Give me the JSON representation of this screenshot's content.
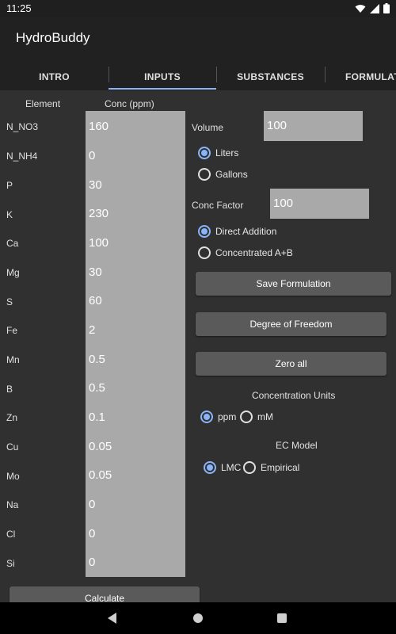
{
  "status": {
    "time": "11:25"
  },
  "app": {
    "title": "HydroBuddy"
  },
  "tabs": [
    {
      "label": "INTRO"
    },
    {
      "label": "INPUTS"
    },
    {
      "label": "SUBSTANCES"
    },
    {
      "label": "FORMULATI"
    }
  ],
  "table": {
    "header_element": "Element",
    "header_conc": "Conc (ppm)",
    "rows": [
      {
        "element": "N_NO3",
        "value": "160"
      },
      {
        "element": "N_NH4",
        "value": "0"
      },
      {
        "element": "P",
        "value": "30"
      },
      {
        "element": "K",
        "value": "230"
      },
      {
        "element": "Ca",
        "value": "100"
      },
      {
        "element": "Mg",
        "value": "30"
      },
      {
        "element": "S",
        "value": "60"
      },
      {
        "element": "Fe",
        "value": "2"
      },
      {
        "element": "Mn",
        "value": "0.5"
      },
      {
        "element": "B",
        "value": "0.5"
      },
      {
        "element": "Zn",
        "value": "0.1"
      },
      {
        "element": "Cu",
        "value": "0.05"
      },
      {
        "element": "Mo",
        "value": "0.05"
      },
      {
        "element": "Na",
        "value": "0"
      },
      {
        "element": "Cl",
        "value": "0"
      },
      {
        "element": "Si",
        "value": "0"
      }
    ]
  },
  "volume": {
    "label": "Volume",
    "value": "100"
  },
  "units": {
    "liters": "Liters",
    "gallons": "Gallons",
    "selected": "liters"
  },
  "conc_factor": {
    "label": "Conc Factor",
    "value": "100"
  },
  "mode": {
    "direct": "Direct Addition",
    "concentrated": "Concentrated A+B",
    "selected": "direct"
  },
  "buttons": {
    "save": "Save Formulation",
    "degree": "Degree of Freedom",
    "zero": "Zero all",
    "calculate": "Calculate"
  },
  "conc_units": {
    "label": "Concentration Units",
    "ppm": "ppm",
    "mm": "mM",
    "selected": "ppm"
  },
  "ec_model": {
    "label": "EC Model",
    "lmc": "LMC",
    "empirical": "Empirical",
    "selected": "lmc"
  },
  "colors": {
    "accent": "#8ab4f8",
    "panel": "#a9a9a9",
    "background": "#303030",
    "button": "#5a5a5a"
  },
  "icons": {
    "status": [
      "wifi-icon",
      "cell-signal-icon",
      "battery-icon"
    ],
    "nav": [
      "back-icon",
      "home-icon",
      "recent-apps-icon"
    ]
  }
}
